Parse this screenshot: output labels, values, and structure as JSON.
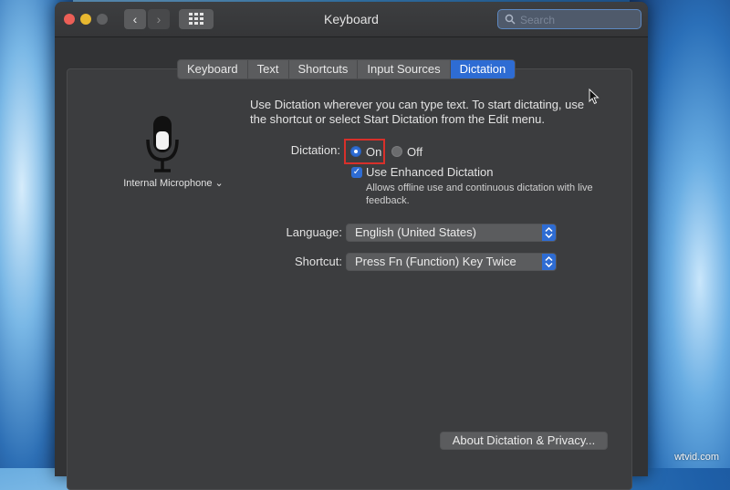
{
  "window": {
    "title": "Keyboard",
    "search_placeholder": "Search"
  },
  "tabs": [
    {
      "label": "Keyboard",
      "active": false
    },
    {
      "label": "Text",
      "active": false
    },
    {
      "label": "Shortcuts",
      "active": false
    },
    {
      "label": "Input Sources",
      "active": false
    },
    {
      "label": "Dictation",
      "active": true
    }
  ],
  "microphone": {
    "label": "Internal Microphone"
  },
  "dictation": {
    "description": "Use Dictation wherever you can type text. To start dictating, use the shortcut or select Start Dictation from the Edit menu.",
    "label": "Dictation:",
    "on_label": "On",
    "off_label": "Off",
    "selected": "On",
    "enhanced_label": "Use Enhanced Dictation",
    "enhanced_checked": true,
    "enhanced_description": "Allows offline use and continuous dictation with live feedback."
  },
  "language": {
    "label": "Language:",
    "value": "English (United States)"
  },
  "shortcut": {
    "label": "Shortcut:",
    "value": "Press Fn (Function) Key Twice"
  },
  "about_button": "About Dictation & Privacy...",
  "watermark": "wtvid.com",
  "colors": {
    "accent": "#2e6cd3",
    "highlight_box": "#d8302a"
  }
}
